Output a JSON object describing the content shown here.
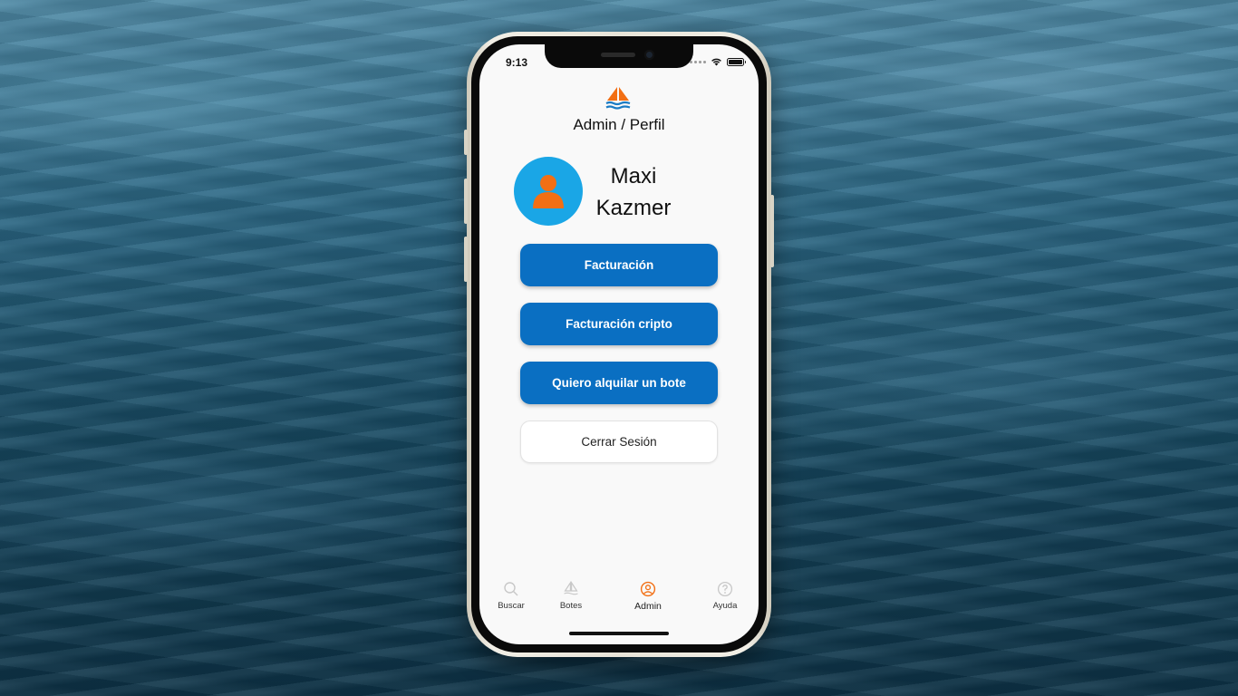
{
  "status_bar": {
    "time": "9:13"
  },
  "header": {
    "title": "Admin / Perfil"
  },
  "profile": {
    "first_name": "Maxi",
    "last_name": "Kazmer"
  },
  "actions": {
    "billing_label": "Facturación",
    "crypto_billing_label": "Facturación cripto",
    "rent_boat_label": "Quiero alquilar un bote",
    "logout_label": "Cerrar Sesión"
  },
  "tabs": [
    {
      "label": "Buscar",
      "icon": "search-icon"
    },
    {
      "label": "Botes",
      "icon": "boat-icon"
    },
    {
      "label": "Admin",
      "icon": "user-icon",
      "active": true
    },
    {
      "label": "Ayuda",
      "icon": "help-icon"
    }
  ],
  "colors": {
    "primary_button": "#0a6fc2",
    "avatar_bg": "#1aa6e6",
    "accent_orange": "#f26f14"
  }
}
